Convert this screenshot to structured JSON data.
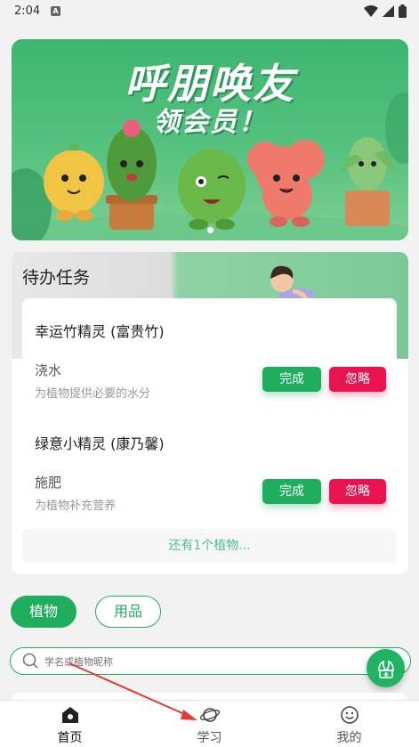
{
  "status_bar": {
    "time": "2:04",
    "notif_letter": "A"
  },
  "banner": {
    "line1": "呼朋唤友",
    "line2": "领会员！"
  },
  "todo": {
    "title": "待办任务",
    "plants": [
      {
        "name": "幸运竹精灵 (富贵竹)",
        "task": "浇水",
        "desc": "为植物提供必要的水分",
        "done_label": "完成",
        "ignore_label": "忽略"
      },
      {
        "name": "绿意小精灵 (康乃馨)",
        "task": "施肥",
        "desc": "为植物补充营养",
        "done_label": "完成",
        "ignore_label": "忽略"
      }
    ],
    "more_label": "还有1个植物..."
  },
  "category_tabs": [
    {
      "label": "植物",
      "active": true
    },
    {
      "label": "用品",
      "active": false
    }
  ],
  "search": {
    "placeholder": "学名或植物昵称"
  },
  "bottom_nav": [
    {
      "label": "首页",
      "icon": "home-icon",
      "active": true
    },
    {
      "label": "学习",
      "icon": "planet-icon",
      "active": false
    },
    {
      "label": "我的",
      "icon": "smiley-icon",
      "active": false
    }
  ],
  "colors": {
    "accent": "#1fae5e",
    "ignore": "#e8134f",
    "annotation": "#e53935"
  }
}
